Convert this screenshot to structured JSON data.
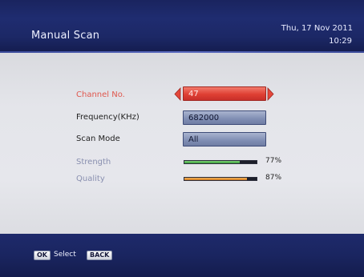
{
  "header": {
    "title": "Manual Scan",
    "date": "Thu, 17 Nov 2011",
    "time": "10:29"
  },
  "rows": {
    "channel": {
      "label": "Channel No.",
      "value": "47"
    },
    "frequency": {
      "label": "Frequency(KHz)",
      "value": "682000"
    },
    "scan_mode": {
      "label": "Scan Mode",
      "value": "All"
    },
    "strength": {
      "label": "Strength",
      "level_percent": 77,
      "text": "77%"
    },
    "quality": {
      "label": "Quality",
      "level_percent": 87,
      "text": "87%"
    }
  },
  "footer": {
    "ok_key": "OK",
    "select_label": "Select",
    "back_key": "BACK"
  },
  "colors": {
    "header_bg": "#1f2c70",
    "selected_field": "#df3f33",
    "field": "#7f8db3",
    "strength_bar": "#3aa03a",
    "quality_bar": "#d37a1c"
  }
}
